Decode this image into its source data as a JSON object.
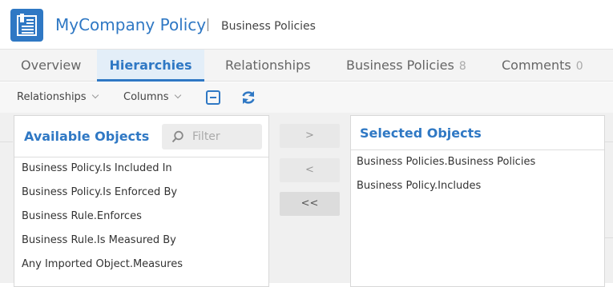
{
  "header": {
    "app_title": "MyCompany Policy",
    "breadcrumb": "Business Policies",
    "brand_color": "#2f78c4",
    "logo_icon": "document-list-icon"
  },
  "tabs": [
    {
      "label": "Overview",
      "count": "",
      "active": false
    },
    {
      "label": "Hierarchies",
      "count": "",
      "active": true
    },
    {
      "label": "Relationships",
      "count": "",
      "active": false
    },
    {
      "label": "Business Policies",
      "count": "8",
      "active": false
    },
    {
      "label": "Comments",
      "count": "0",
      "active": false
    }
  ],
  "toolbar": {
    "relationships_label": "Relationships",
    "columns_label": "Columns",
    "collapse_icon": "collapse-icon",
    "refresh_icon": "refresh-icon"
  },
  "available": {
    "title": "Available Objects",
    "filter_placeholder": "Filter",
    "items": [
      "Business Policy.Is Included In",
      "Business Policy.Is Enforced By",
      "Business Rule.Enforces",
      "Business Rule.Is Measured By",
      "Any Imported Object.Measures"
    ]
  },
  "move_buttons": {
    "add": ">",
    "remove": "<",
    "remove_all": "<<"
  },
  "selected": {
    "title": "Selected Objects",
    "items": [
      "Business Policies.Business Policies",
      "Business Policy.Includes"
    ]
  }
}
